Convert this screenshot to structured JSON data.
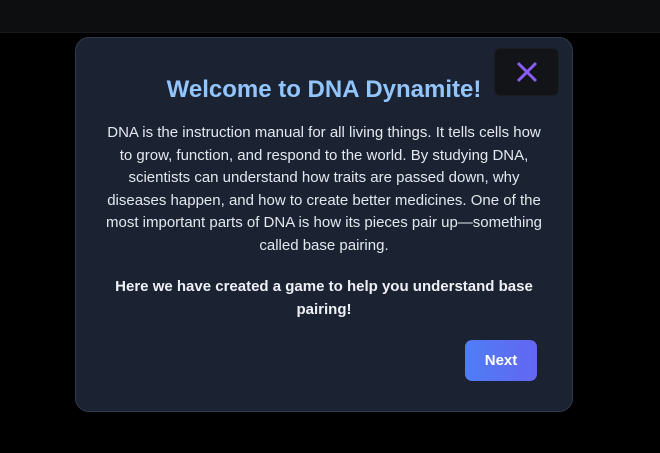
{
  "modal": {
    "title": "Welcome to DNA Dynamite!",
    "body": "DNA is the instruction manual for all living things. It tells cells how to grow, function, and respond to the world. By studying DNA, scientists can understand how traits are passed down, why diseases happen, and how to create better medicines. One of the most important parts of DNA is how its pieces pair up—something called base pairing.",
    "cta": "Here we have created a game to help you understand base pairing!",
    "next_label": "Next",
    "close_icon": "close-icon"
  },
  "colors": {
    "background": "#000000",
    "modal_background": "#1b2333",
    "title": "#93c5fd",
    "close_icon": "#8b5cf6",
    "next_button_start": "#4f7df5",
    "next_button_end": "#6366f1"
  }
}
